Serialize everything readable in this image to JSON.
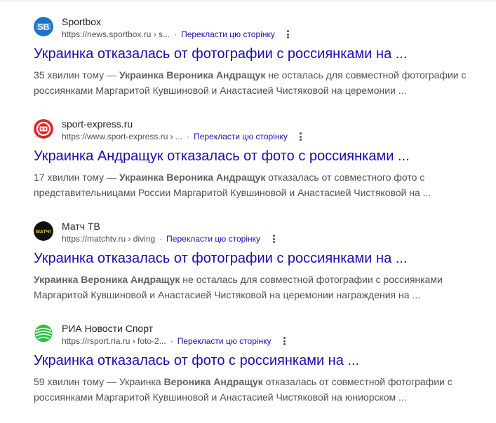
{
  "results": [
    {
      "favicon": "sportbox-logo-icon",
      "favicon_text": "SB",
      "site": "Sportbox",
      "url": "https://news.sportbox.ru › s...",
      "translate": "Перекласти цю сторінку",
      "title": "Украинка отказалась от фотографии с россиянками на ...",
      "snippet_lines": [
        [
          {
            "t": "35 хвилин тому — ",
            "b": false
          },
          {
            "t": "Украинка Вероника Андращук",
            "b": true
          },
          {
            "t": " не осталась для совместной фотографии с",
            "b": false
          }
        ],
        [
          {
            "t": "россиянками Маргаритой Кувшиновой и Анастасией Чистяковой на церемонии ...",
            "b": false
          }
        ]
      ]
    },
    {
      "favicon": "sport-express-logo-icon",
      "favicon_text": "",
      "site": "sport-express.ru",
      "url": "https://www.sport-express.ru › ...",
      "translate": "Перекласти цю сторінку",
      "title": "Украинка Андращук отказалась от фото с россиянками ...",
      "snippet_lines": [
        [
          {
            "t": "17 хвилин тому — ",
            "b": false
          },
          {
            "t": "Украинка Вероника Андращук",
            "b": true
          },
          {
            "t": " отказалась от совместного фото с",
            "b": false
          }
        ],
        [
          {
            "t": "представительницами России Маргаритой Кувшиновой и Анастасией Чистяковой на ...",
            "b": false
          }
        ]
      ]
    },
    {
      "favicon": "match-tv-logo-icon",
      "favicon_text": "МАТЧ!",
      "site": "Матч ТВ",
      "url": "https://matchtv.ru › diving",
      "translate": "Перекласти цю сторінку",
      "title": "Украинка отказалась от фотографии с россиянками на ...",
      "snippet_lines": [
        [
          {
            "t": "Украинка Вероника Андращук",
            "b": true
          },
          {
            "t": " не осталась для совместной фотографии с россиянками",
            "b": false
          }
        ],
        [
          {
            "t": "Маргаритой Кувшиновой и Анастасией Чистяковой на церемонии награждения на ...",
            "b": false
          }
        ]
      ]
    },
    {
      "favicon": "ria-novosti-sport-logo-icon",
      "favicon_text": "",
      "site": "РИА Новости Спорт",
      "url": "https://rsport.ria.ru › foto-2...",
      "translate": "Перекласти цю сторінку",
      "title": "Украинка отказалась от фото с россиянками на ...",
      "snippet_lines": [
        [
          {
            "t": "59 хвилин тому — Украинка ",
            "b": false
          },
          {
            "t": "Вероника Андращук",
            "b": true
          },
          {
            "t": " отказалась от совместной фотографии с",
            "b": false
          }
        ],
        [
          {
            "t": "россиянками Маргаритой Кувшиновой и Анастасией Чистяковой на юниорском ...",
            "b": false
          }
        ]
      ]
    }
  ],
  "colors": {
    "title_link": "#1a0dab",
    "snippet": "#4d5156",
    "sportbox": "#1a73c8",
    "sport_express": "#e3262b",
    "match_tv": "#111111",
    "ria": "#2fbf4a"
  }
}
